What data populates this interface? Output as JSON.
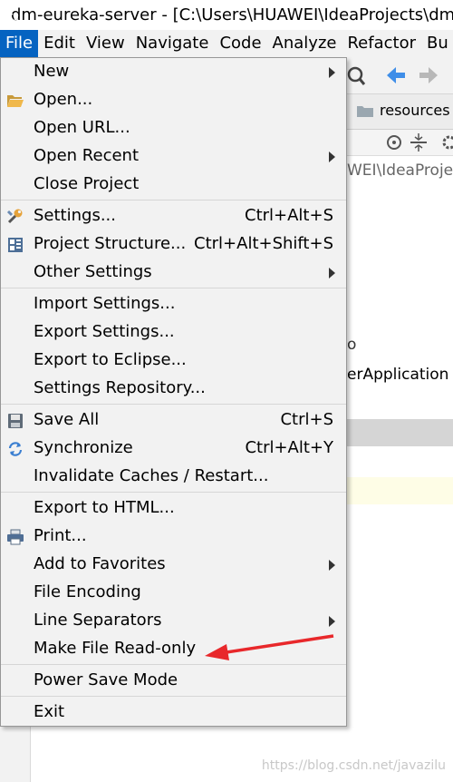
{
  "window": {
    "title": "dm-eureka-server - [C:\\Users\\HUAWEI\\IdeaProjects\\dm"
  },
  "menubar": [
    "File",
    "Edit",
    "View",
    "Navigate",
    "Code",
    "Analyze",
    "Refactor",
    "Bu"
  ],
  "background": {
    "tab_label": "resources",
    "path_text": "WEI\\IdeaProje",
    "code_line_1": "o",
    "code_line_2": "erApplication",
    "watermark": "https://blog.csdn.net/javazilu"
  },
  "file_menu": {
    "groups": [
      [
        {
          "label": "New",
          "shortcut": "",
          "submenu": true,
          "icon": ""
        },
        {
          "label": "Open...",
          "shortcut": "",
          "submenu": false,
          "icon": "folder-icon"
        },
        {
          "label": "Open URL...",
          "shortcut": "",
          "submenu": false,
          "icon": ""
        },
        {
          "label": "Open Recent",
          "shortcut": "",
          "submenu": true,
          "icon": ""
        },
        {
          "label": "Close Project",
          "shortcut": "",
          "submenu": false,
          "icon": ""
        }
      ],
      [
        {
          "label": "Settings...",
          "shortcut": "Ctrl+Alt+S",
          "submenu": false,
          "icon": "wrench-icon"
        },
        {
          "label": "Project Structure...",
          "shortcut": "Ctrl+Alt+Shift+S",
          "submenu": false,
          "icon": "project-structure-icon"
        },
        {
          "label": "Other Settings",
          "shortcut": "",
          "submenu": true,
          "icon": ""
        }
      ],
      [
        {
          "label": "Import Settings...",
          "shortcut": "",
          "submenu": false,
          "icon": ""
        },
        {
          "label": "Export Settings...",
          "shortcut": "",
          "submenu": false,
          "icon": ""
        },
        {
          "label": "Export to Eclipse...",
          "shortcut": "",
          "submenu": false,
          "icon": ""
        },
        {
          "label": "Settings Repository...",
          "shortcut": "",
          "submenu": false,
          "icon": ""
        }
      ],
      [
        {
          "label": "Save All",
          "shortcut": "Ctrl+S",
          "submenu": false,
          "icon": "save-icon"
        },
        {
          "label": "Synchronize",
          "shortcut": "Ctrl+Alt+Y",
          "submenu": false,
          "icon": "sync-icon"
        },
        {
          "label": "Invalidate Caches / Restart...",
          "shortcut": "",
          "submenu": false,
          "icon": ""
        }
      ],
      [
        {
          "label": "Export to HTML...",
          "shortcut": "",
          "submenu": false,
          "icon": ""
        },
        {
          "label": "Print...",
          "shortcut": "",
          "submenu": false,
          "icon": "printer-icon"
        },
        {
          "label": "Add to Favorites",
          "shortcut": "",
          "submenu": true,
          "icon": ""
        },
        {
          "label": "File Encoding",
          "shortcut": "",
          "submenu": false,
          "icon": ""
        },
        {
          "label": "Line Separators",
          "shortcut": "",
          "submenu": true,
          "icon": ""
        },
        {
          "label": "Make File Read-only",
          "shortcut": "",
          "submenu": false,
          "icon": ""
        }
      ],
      [
        {
          "label": "Power Save Mode",
          "shortcut": "",
          "submenu": false,
          "icon": ""
        }
      ],
      [
        {
          "label": "Exit",
          "shortcut": "",
          "submenu": false,
          "icon": ""
        }
      ]
    ]
  },
  "colors": {
    "menu_active": "#0563c1",
    "annotation": "#e8282b"
  }
}
